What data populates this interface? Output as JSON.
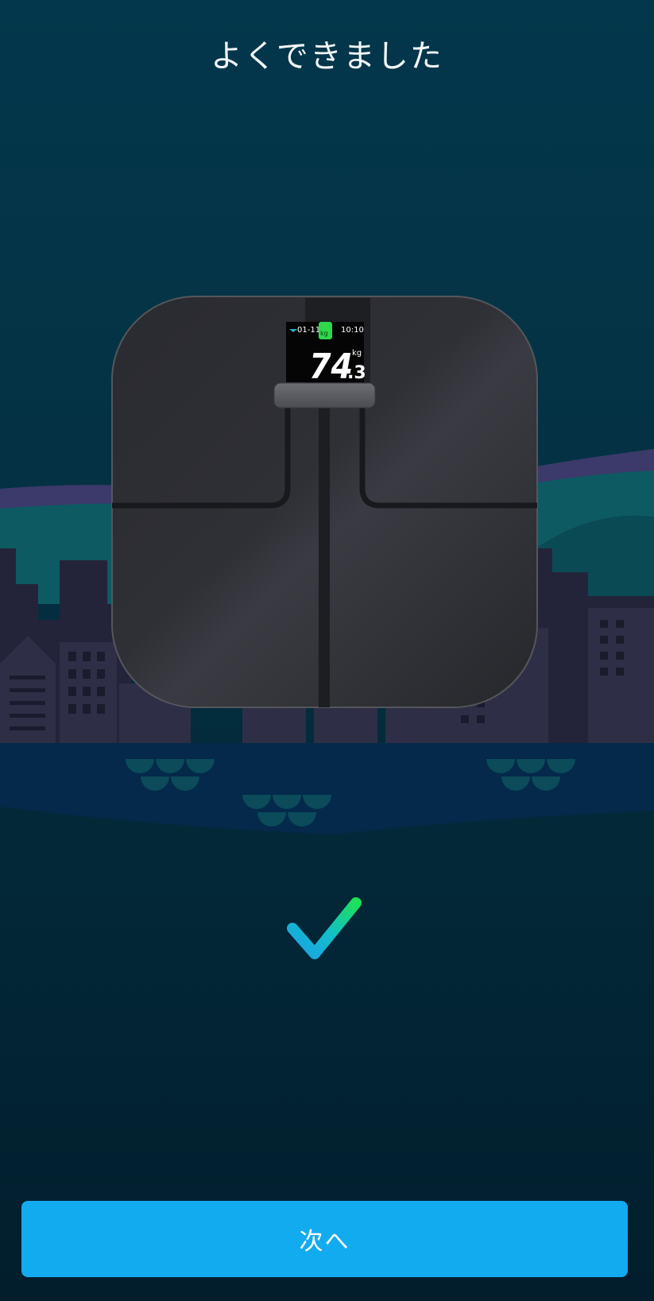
{
  "header": {
    "title": "よくできました"
  },
  "scale_display": {
    "date": "01-11",
    "time": "10:10",
    "weight_integer": "74",
    "weight_decimal": ".3",
    "unit": "kg"
  },
  "footer": {
    "next_label": "次へ"
  },
  "colors": {
    "background_top": "#03374b",
    "background_bottom": "#021e2c",
    "button": "#13abef",
    "check_start": "#1aa0e6",
    "check_end": "#1ee05a"
  }
}
